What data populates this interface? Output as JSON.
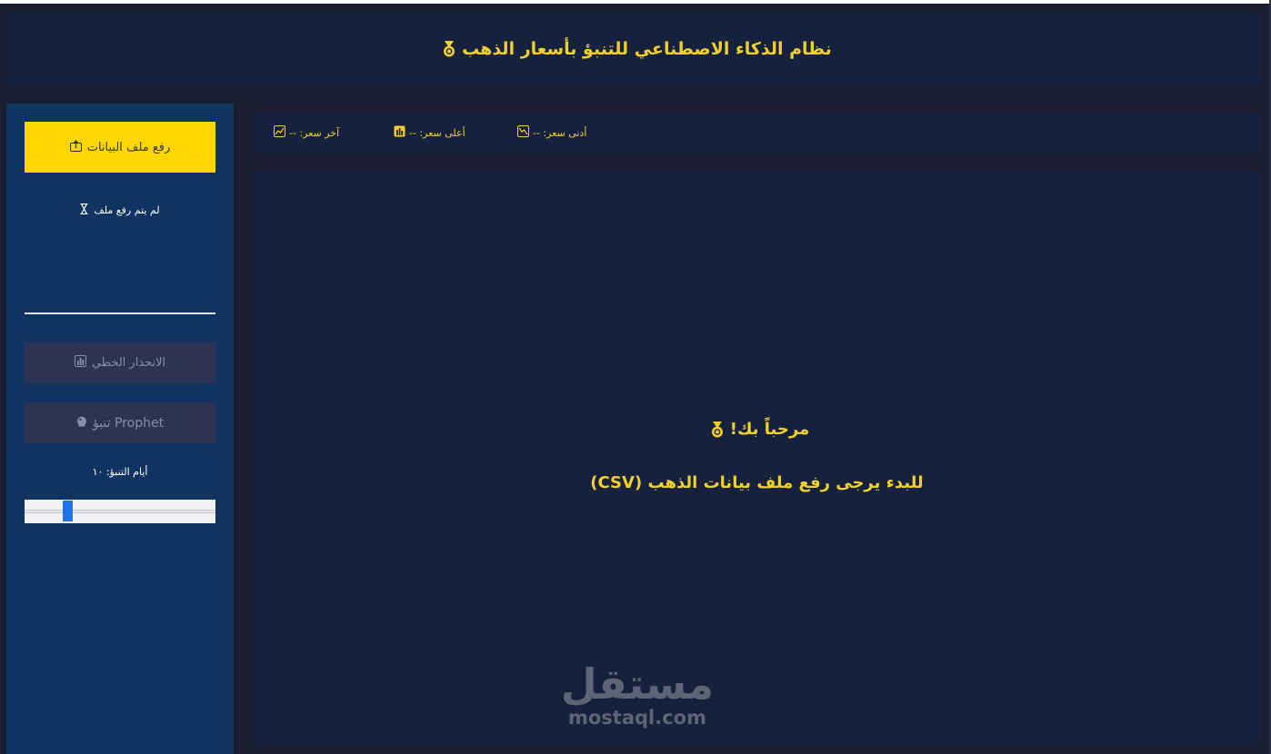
{
  "header": {
    "title": "نظام الذكاء الاصطناعي للتنبؤ بأسعار الذهب",
    "icon": "medal-icon"
  },
  "sidebar": {
    "upload_label": "رفع ملف البيانات",
    "upload_icon": "upload-icon",
    "upload_status": "لم يتم رفع ملف",
    "status_icon": "hourglass-icon",
    "linear_label": "الانحدار الخطي",
    "linear_icon": "bar-chart-icon",
    "prophet_label": "Prophet تنبؤ",
    "prophet_icon": "crystal-ball-icon",
    "days_label": "أيام التنبؤ: ١٠",
    "days_value": 10,
    "slider_fraction": 0.21
  },
  "stats": {
    "last_price": "آخر سعر: --",
    "high_price": "أعلى سعر: --",
    "low_price": "أدنى سعر: --"
  },
  "main": {
    "welcome_title": "مرحباً بك!",
    "welcome_sub": "للبدء يرجى رفع ملف بيانات الذهب (CSV)"
  },
  "watermark": {
    "arabic": "مستقل",
    "english": "mostaql.com"
  },
  "colors": {
    "accent": "#ffd600",
    "gold_text": "#f3cf2a",
    "panel": "#15213d",
    "sidebar": "#0f3462",
    "background": "#1b1e30"
  }
}
